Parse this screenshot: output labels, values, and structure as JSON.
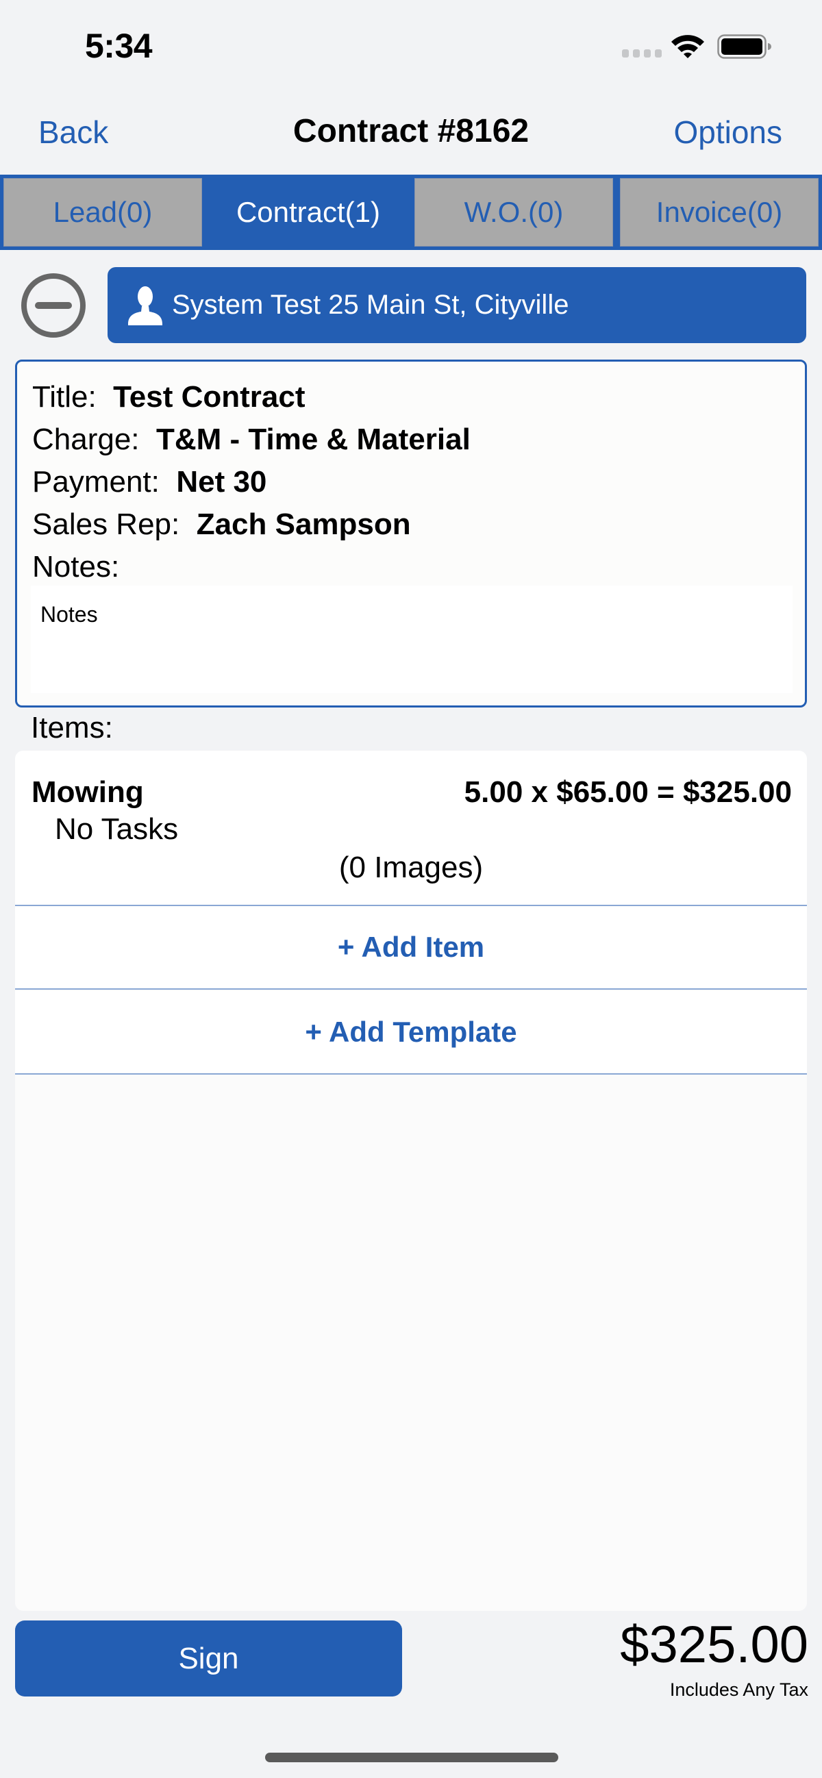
{
  "status_bar": {
    "time": "5:34",
    "icons": [
      "signal-icon",
      "wifi-icon",
      "battery-icon"
    ]
  },
  "nav": {
    "back_label": "Back",
    "title": "Contract #8162",
    "options_label": "Options"
  },
  "tabs": [
    {
      "label": "Lead(0)",
      "active": false
    },
    {
      "label": "Contract(1)",
      "active": true
    },
    {
      "label": "W.O.(0)",
      "active": false
    },
    {
      "label": "Invoice(0)",
      "active": false
    }
  ],
  "customer": {
    "icon": "person-icon",
    "label": "System Test 25 Main St, Cityville",
    "remove_icon": "minus-circle-icon"
  },
  "details": {
    "title_label": "Title:",
    "title_value": "Test Contract",
    "charge_label": "Charge:",
    "charge_value": "T&M - Time & Material",
    "payment_label": "Payment:",
    "payment_value": "Net 30",
    "sales_rep_label": "Sales Rep:",
    "sales_rep_value": "Zach Sampson",
    "notes_label": "Notes:",
    "notes_value": "Notes"
  },
  "items": {
    "label": "Items:",
    "rows": [
      {
        "name": "Mowing",
        "calculation": "5.00 x $65.00 = $325.00",
        "tasks": "No Tasks",
        "images": "(0 Images)"
      }
    ],
    "add_item_label": "+ Add Item",
    "add_template_label": "+ Add Template"
  },
  "footer": {
    "sign_label": "Sign",
    "total": "$325.00",
    "tax_note": "Includes Any Tax"
  },
  "colors": {
    "accent": "#235eb3",
    "tab_inactive_bg": "#a9a9a9",
    "background": "#f2f3f5",
    "separator": "#8aa7d4"
  }
}
